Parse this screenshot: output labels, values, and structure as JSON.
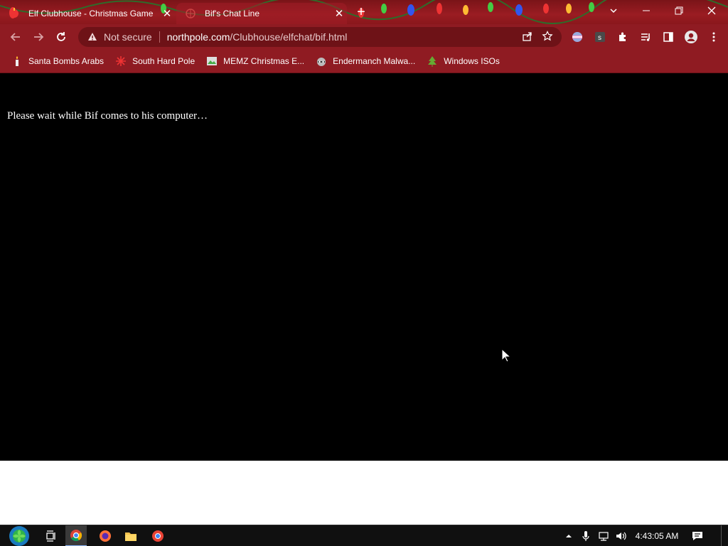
{
  "browser": {
    "tabs": [
      {
        "title": "Elf Clubhouse - Christmas Game",
        "active": false
      },
      {
        "title": "Bif's Chat Line",
        "active": true
      }
    ],
    "security_label": "Not secure",
    "url_host": "northpole.com",
    "url_path": "/Clubhouse/elfchat/bif.html",
    "bookmarks": [
      {
        "label": "Santa Bombs Arabs",
        "icon": "candle-icon"
      },
      {
        "label": "South Hard Pole",
        "icon": "snowflake-icon"
      },
      {
        "label": "MEMZ Christmas E...",
        "icon": "image-icon"
      },
      {
        "label": "Endermanch Malwa...",
        "icon": "raccoon-icon"
      },
      {
        "label": "Windows ISOs",
        "icon": "tree-icon"
      }
    ]
  },
  "page": {
    "message": "Please wait while Bif comes to his computer…",
    "background": "#000000",
    "text_color": "#ffffff"
  },
  "theme": {
    "frame_color": "#8f1b22",
    "title_color": "#7a1418"
  },
  "taskbar": {
    "time": "4:43:05 AM"
  }
}
